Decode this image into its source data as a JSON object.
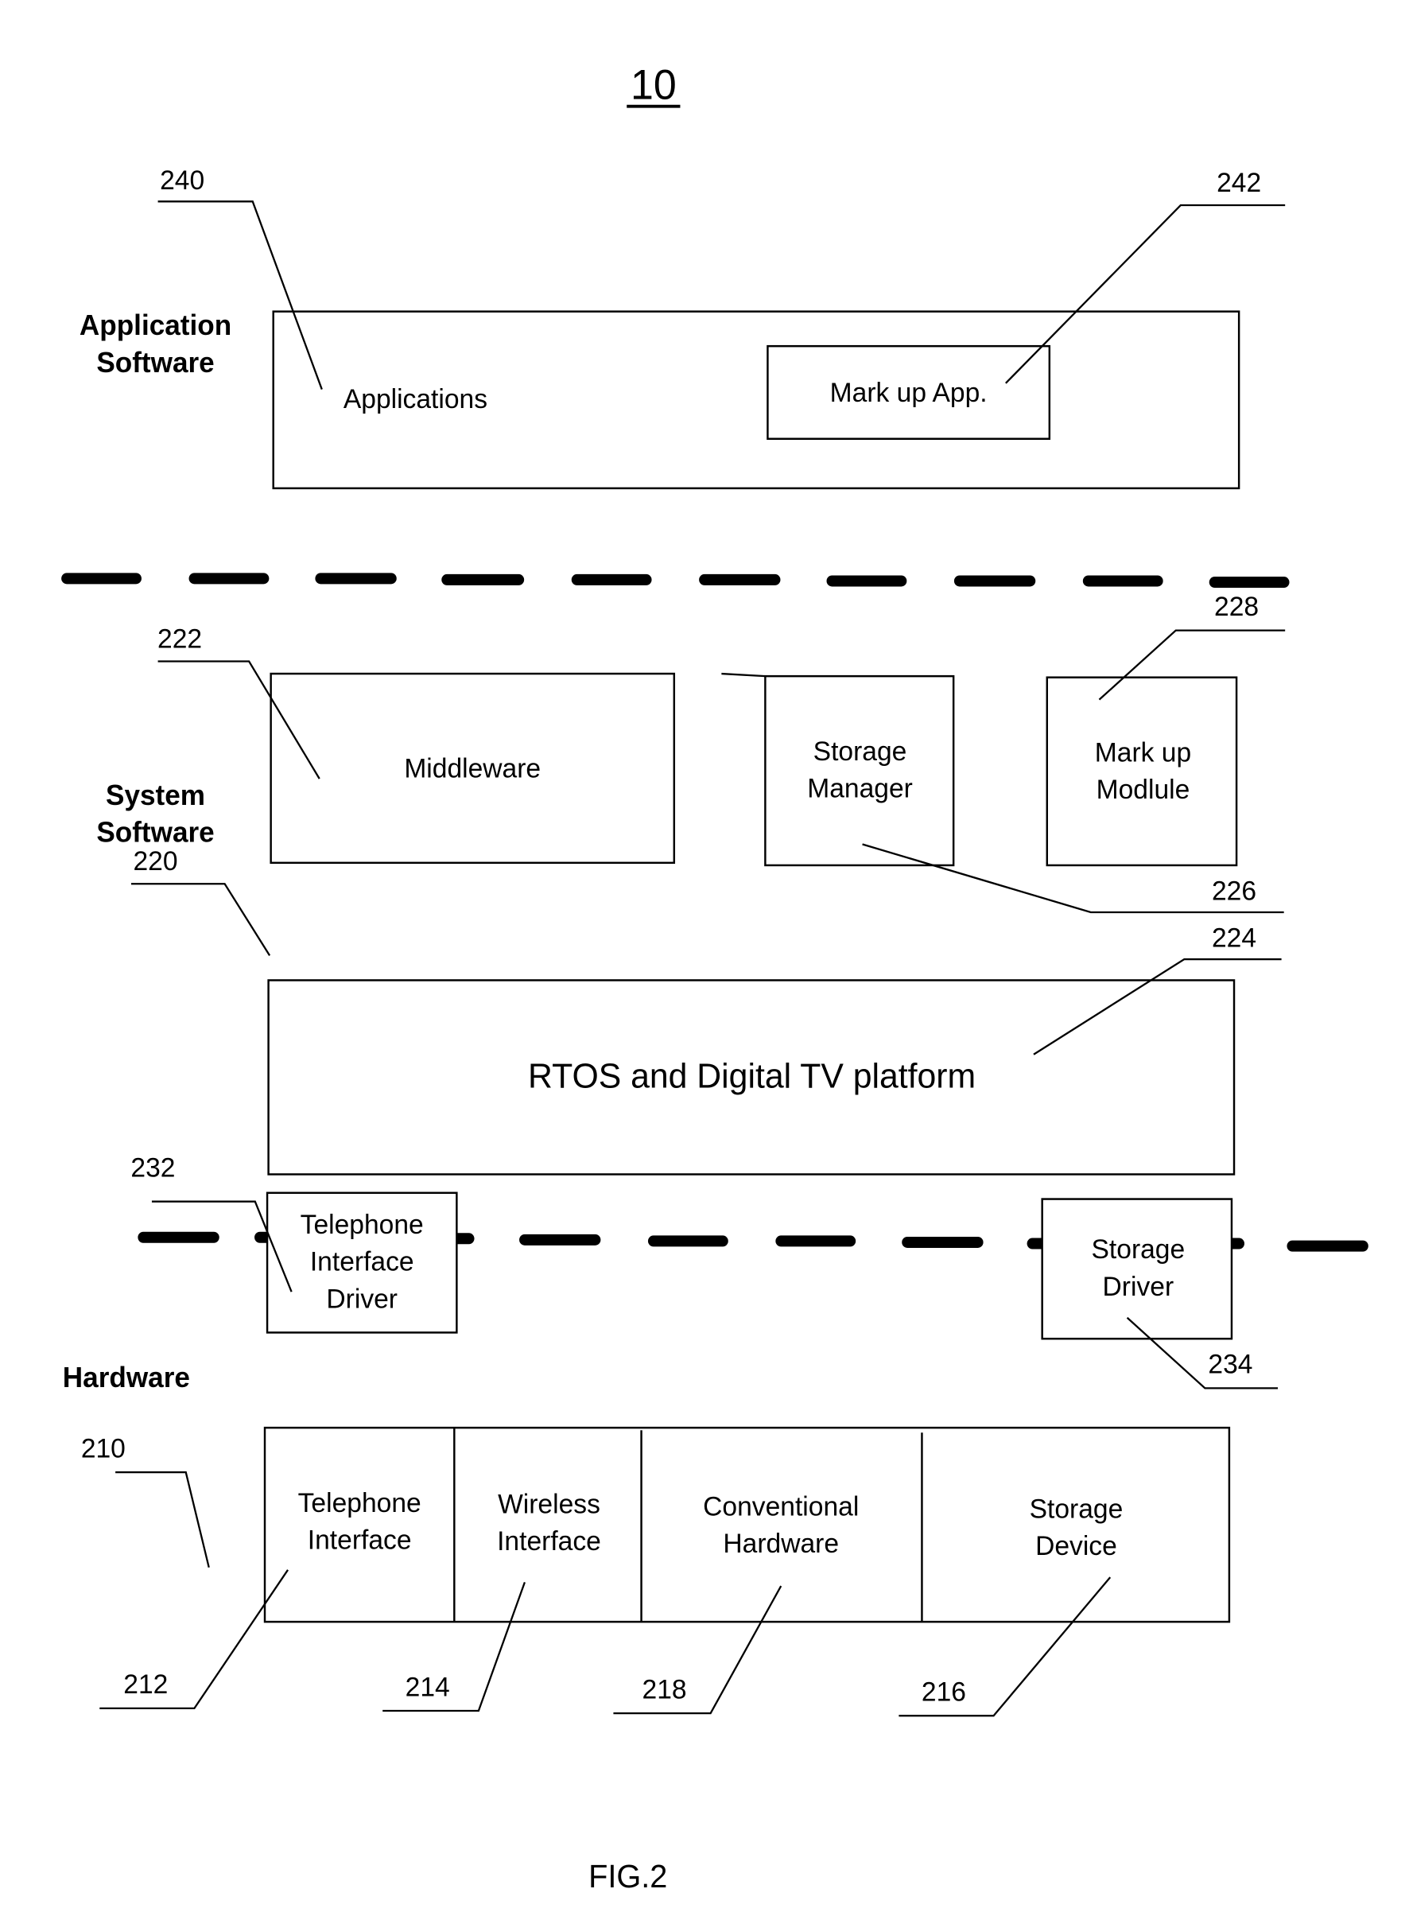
{
  "figure": {
    "number": "10",
    "caption": "FIG.2"
  },
  "layers": {
    "application": [
      "Application",
      "Software"
    ],
    "system": [
      "System",
      "Software"
    ],
    "hardware": "Hardware"
  },
  "refs": {
    "r240": "240",
    "r242": "242",
    "r222": "222",
    "r228": "228",
    "r226": "226",
    "r220": "220",
    "r224": "224",
    "r232": "232",
    "r234": "234",
    "r210": "210",
    "r212": "212",
    "r214": "214",
    "r218": "218",
    "r216": "216"
  },
  "blocks": {
    "applications": "Applications",
    "markup_app": "Mark up App.",
    "middleware": "Middleware",
    "storage_manager": [
      "Storage",
      "Manager"
    ],
    "markup_module": [
      "Mark up",
      "Modlule"
    ],
    "rtos": "RTOS and Digital TV platform",
    "telephone_interface_driver": [
      "Telephone",
      "Interface",
      "Driver"
    ],
    "storage_driver": [
      "Storage",
      "Driver"
    ],
    "telephone_interface": [
      "Telephone",
      "Interface"
    ],
    "wireless_interface": [
      "Wireless",
      "Interface"
    ],
    "conventional_hardware": [
      "Conventional",
      "Hardware"
    ],
    "storage_device": [
      "Storage",
      "Device"
    ]
  }
}
